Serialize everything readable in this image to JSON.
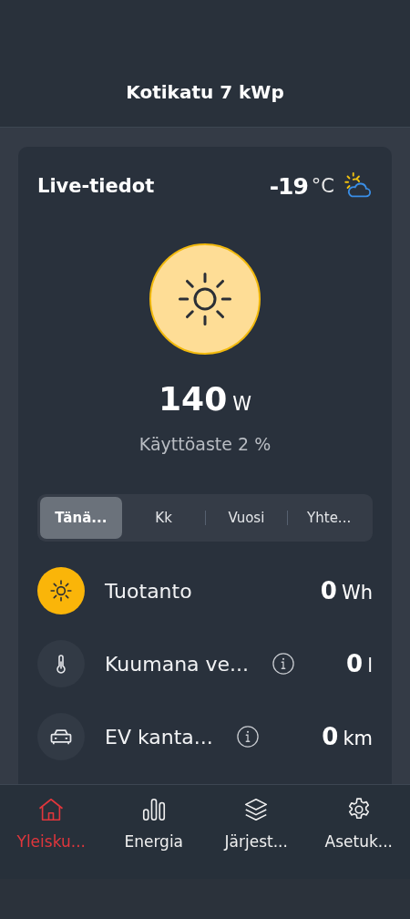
{
  "header": {
    "title": "Kotikatu 7 kWp"
  },
  "live": {
    "title": "Live-tiedot",
    "temperature": "-19",
    "temperature_unit": "°C",
    "power": "140",
    "power_unit": "W",
    "utilization": "Käyttöaste 2 %"
  },
  "tabs": [
    {
      "label": "Tänä...",
      "selected": true
    },
    {
      "label": "Kk",
      "selected": false
    },
    {
      "label": "Vuosi",
      "selected": false
    },
    {
      "label": "Yhte...",
      "selected": false
    }
  ],
  "metrics": [
    {
      "kind": "sun",
      "label": "Tuotanto",
      "value": "0",
      "unit": "Wh",
      "info": false,
      "active": true
    },
    {
      "kind": "thermometer",
      "label": "Kuumana ve...",
      "value": "0",
      "unit": "l",
      "info": true,
      "active": false
    },
    {
      "kind": "car",
      "label": "EV kanta...",
      "value": "0",
      "unit": "km",
      "info": true,
      "active": false
    }
  ],
  "nav": [
    {
      "kind": "home",
      "label": "Yleisku...",
      "selected": true
    },
    {
      "kind": "bars",
      "label": "Energia",
      "selected": false
    },
    {
      "kind": "layers",
      "label": "Järjest...",
      "selected": false
    },
    {
      "kind": "gear",
      "label": "Asetuk...",
      "selected": false
    }
  ]
}
